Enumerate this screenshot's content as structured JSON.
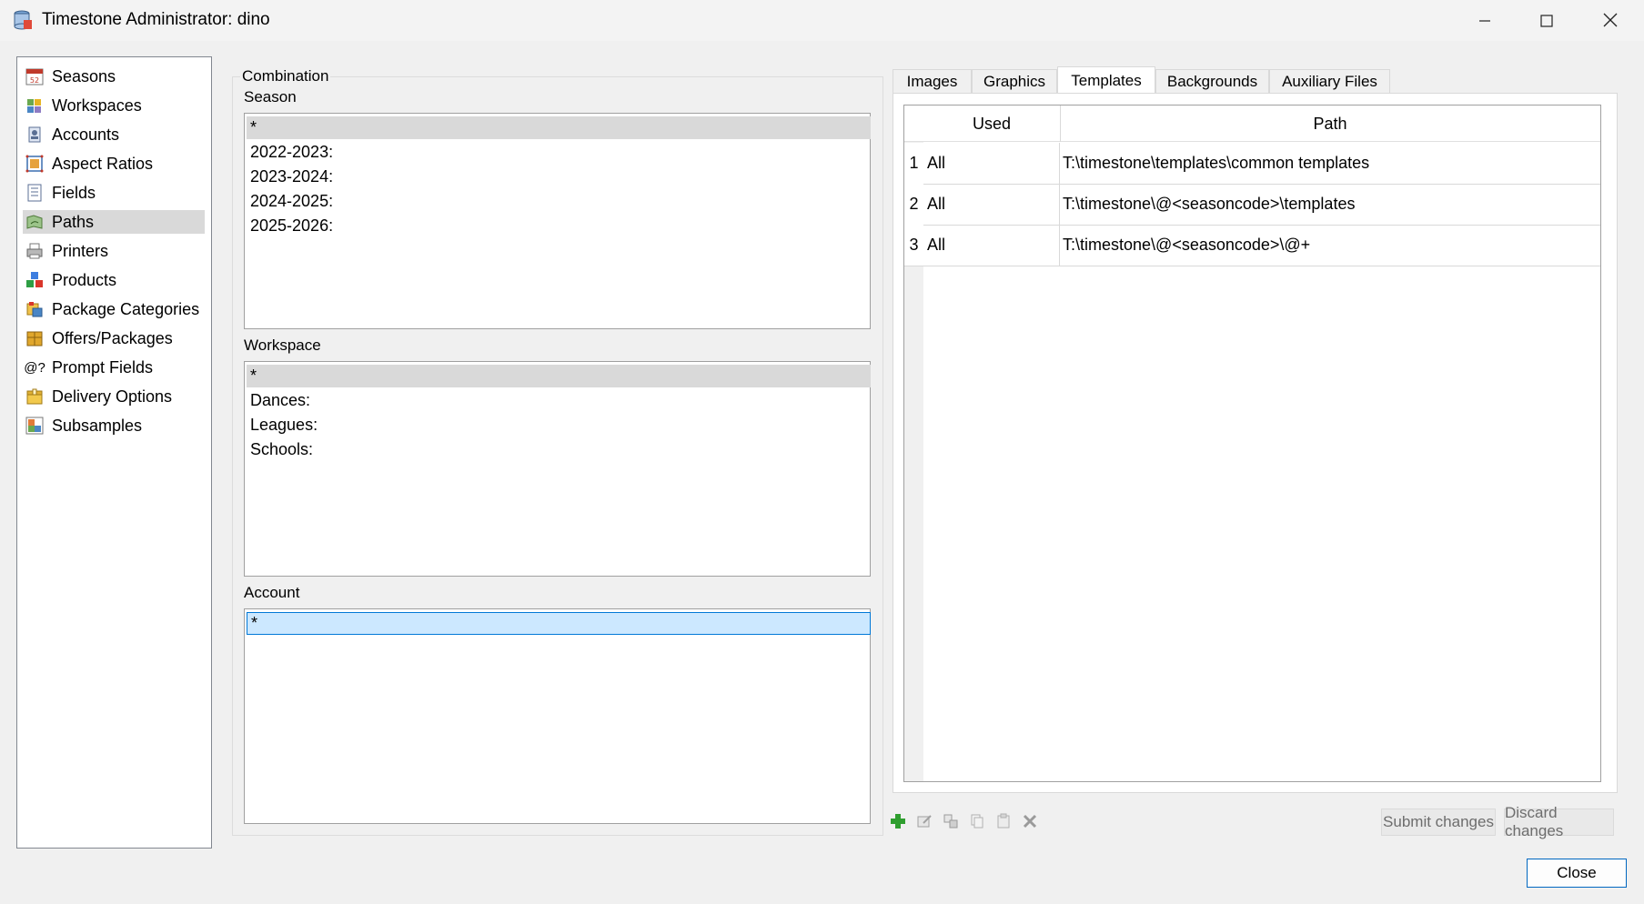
{
  "window": {
    "title": "Timestone Administrator: dino",
    "minimize_icon": "minimize-icon",
    "maximize_icon": "maximize-icon",
    "close_icon": "close-icon"
  },
  "nav": {
    "selected": "Paths",
    "items": [
      {
        "label": "Seasons",
        "icon": "calendar-icon"
      },
      {
        "label": "Workspaces",
        "icon": "workspaces-icon"
      },
      {
        "label": "Accounts",
        "icon": "accounts-icon"
      },
      {
        "label": "Aspect Ratios",
        "icon": "aspect-ratio-icon"
      },
      {
        "label": "Fields",
        "icon": "fields-icon"
      },
      {
        "label": "Paths",
        "icon": "paths-icon"
      },
      {
        "label": "Printers",
        "icon": "printer-icon"
      },
      {
        "label": "Products",
        "icon": "products-icon"
      },
      {
        "label": "Package Categories",
        "icon": "package-categories-icon"
      },
      {
        "label": "Offers/Packages",
        "icon": "offers-packages-icon"
      },
      {
        "label": "Prompt Fields",
        "icon": "prompt-fields-icon",
        "glyph": "@?"
      },
      {
        "label": "Delivery Options",
        "icon": "delivery-options-icon"
      },
      {
        "label": "Subsamples",
        "icon": "subsamples-icon"
      }
    ]
  },
  "combination": {
    "label": "Combination",
    "season": {
      "label": "Season",
      "items": [
        "*",
        "2022-2023:",
        "2023-2024:",
        "2024-2025:",
        "2025-2026:"
      ],
      "selected": "*"
    },
    "workspace": {
      "label": "Workspace",
      "items": [
        "*",
        "Dances:",
        "Leagues:",
        "Schools:"
      ],
      "selected": "*"
    },
    "account": {
      "label": "Account",
      "items": [
        "*"
      ],
      "selected": "*"
    }
  },
  "tabs": {
    "active": "Templates",
    "items": [
      "Images",
      "Graphics",
      "Templates",
      "Backgrounds",
      "Auxiliary Files"
    ]
  },
  "grid": {
    "columns": [
      "Used",
      "Path"
    ],
    "rows": [
      {
        "num": "1",
        "used": "All",
        "path": "T:\\timestone\\templates\\common templates"
      },
      {
        "num": "2",
        "used": "All",
        "path": "T:\\timestone\\@<seasoncode>\\templates"
      },
      {
        "num": "3",
        "used": "All",
        "path": "T:\\timestone\\@<seasoncode>\\@+"
      }
    ]
  },
  "toolbar": {
    "icons": [
      "add-icon",
      "edit-icon",
      "duplicate-icon",
      "copy-icon",
      "paste-icon",
      "delete-icon"
    ]
  },
  "buttons": {
    "submit": "Submit changes",
    "discard": "Discard changes",
    "close": "Close"
  },
  "colors": {
    "selection_gray": "#d9d9d9",
    "selection_blue": "#cce8ff",
    "focus_border": "#0078d7",
    "add_green": "#2f9e2f"
  }
}
